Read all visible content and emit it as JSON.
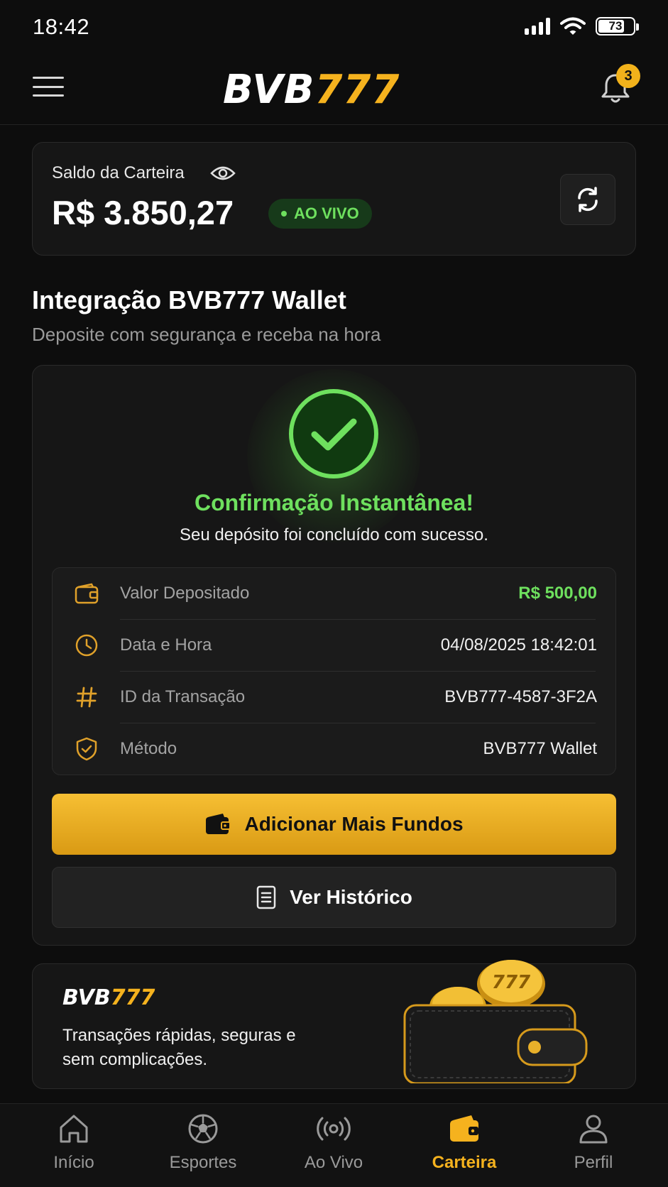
{
  "status_bar": {
    "time": "18:42",
    "battery": "73"
  },
  "header": {
    "logo_white": "BVB",
    "logo_gold": "777",
    "notification_count": "3"
  },
  "balance": {
    "label": "Saldo da Carteira",
    "amount": "R$ 3.850,27",
    "live_label": "AO VIVO"
  },
  "section": {
    "title": "Integração BVB777 Wallet",
    "subtitle": "Deposite com segurança e receba na hora"
  },
  "confirmation": {
    "title": "Confirmação Instantânea!",
    "subtitle": "Seu depósito foi concluído com sucesso.",
    "details": [
      {
        "label": "Valor Depositado",
        "value": "R$ 500,00",
        "icon": "wallet-icon"
      },
      {
        "label": "Data e Hora",
        "value": "04/08/2025 18:42:01",
        "icon": "clock-icon"
      },
      {
        "label": "ID da Transação",
        "value": "BVB777-4587-3F2A",
        "icon": "hash-icon"
      },
      {
        "label": "Método",
        "value": "BVB777 Wallet",
        "icon": "shield-check-icon"
      }
    ],
    "primary_button": "Adicionar Mais Fundos",
    "secondary_button": "Ver Histórico"
  },
  "promo": {
    "logo_white": "BVB",
    "logo_gold": "777",
    "text": "Transações rápidas, seguras e sem complicações.",
    "coin_label": "777"
  },
  "bottom_nav": {
    "items": [
      {
        "label": "Início",
        "icon": "home-icon"
      },
      {
        "label": "Esportes",
        "icon": "soccer-ball-icon"
      },
      {
        "label": "Ao Vivo",
        "icon": "live-broadcast-icon"
      },
      {
        "label": "Carteira",
        "icon": "wallet-icon",
        "active": true
      },
      {
        "label": "Perfil",
        "icon": "user-icon"
      }
    ]
  },
  "colors": {
    "accent_gold": "#f5b21e",
    "success_green": "#6ee05e",
    "background": "#0d0d0d",
    "card": "#161616"
  }
}
